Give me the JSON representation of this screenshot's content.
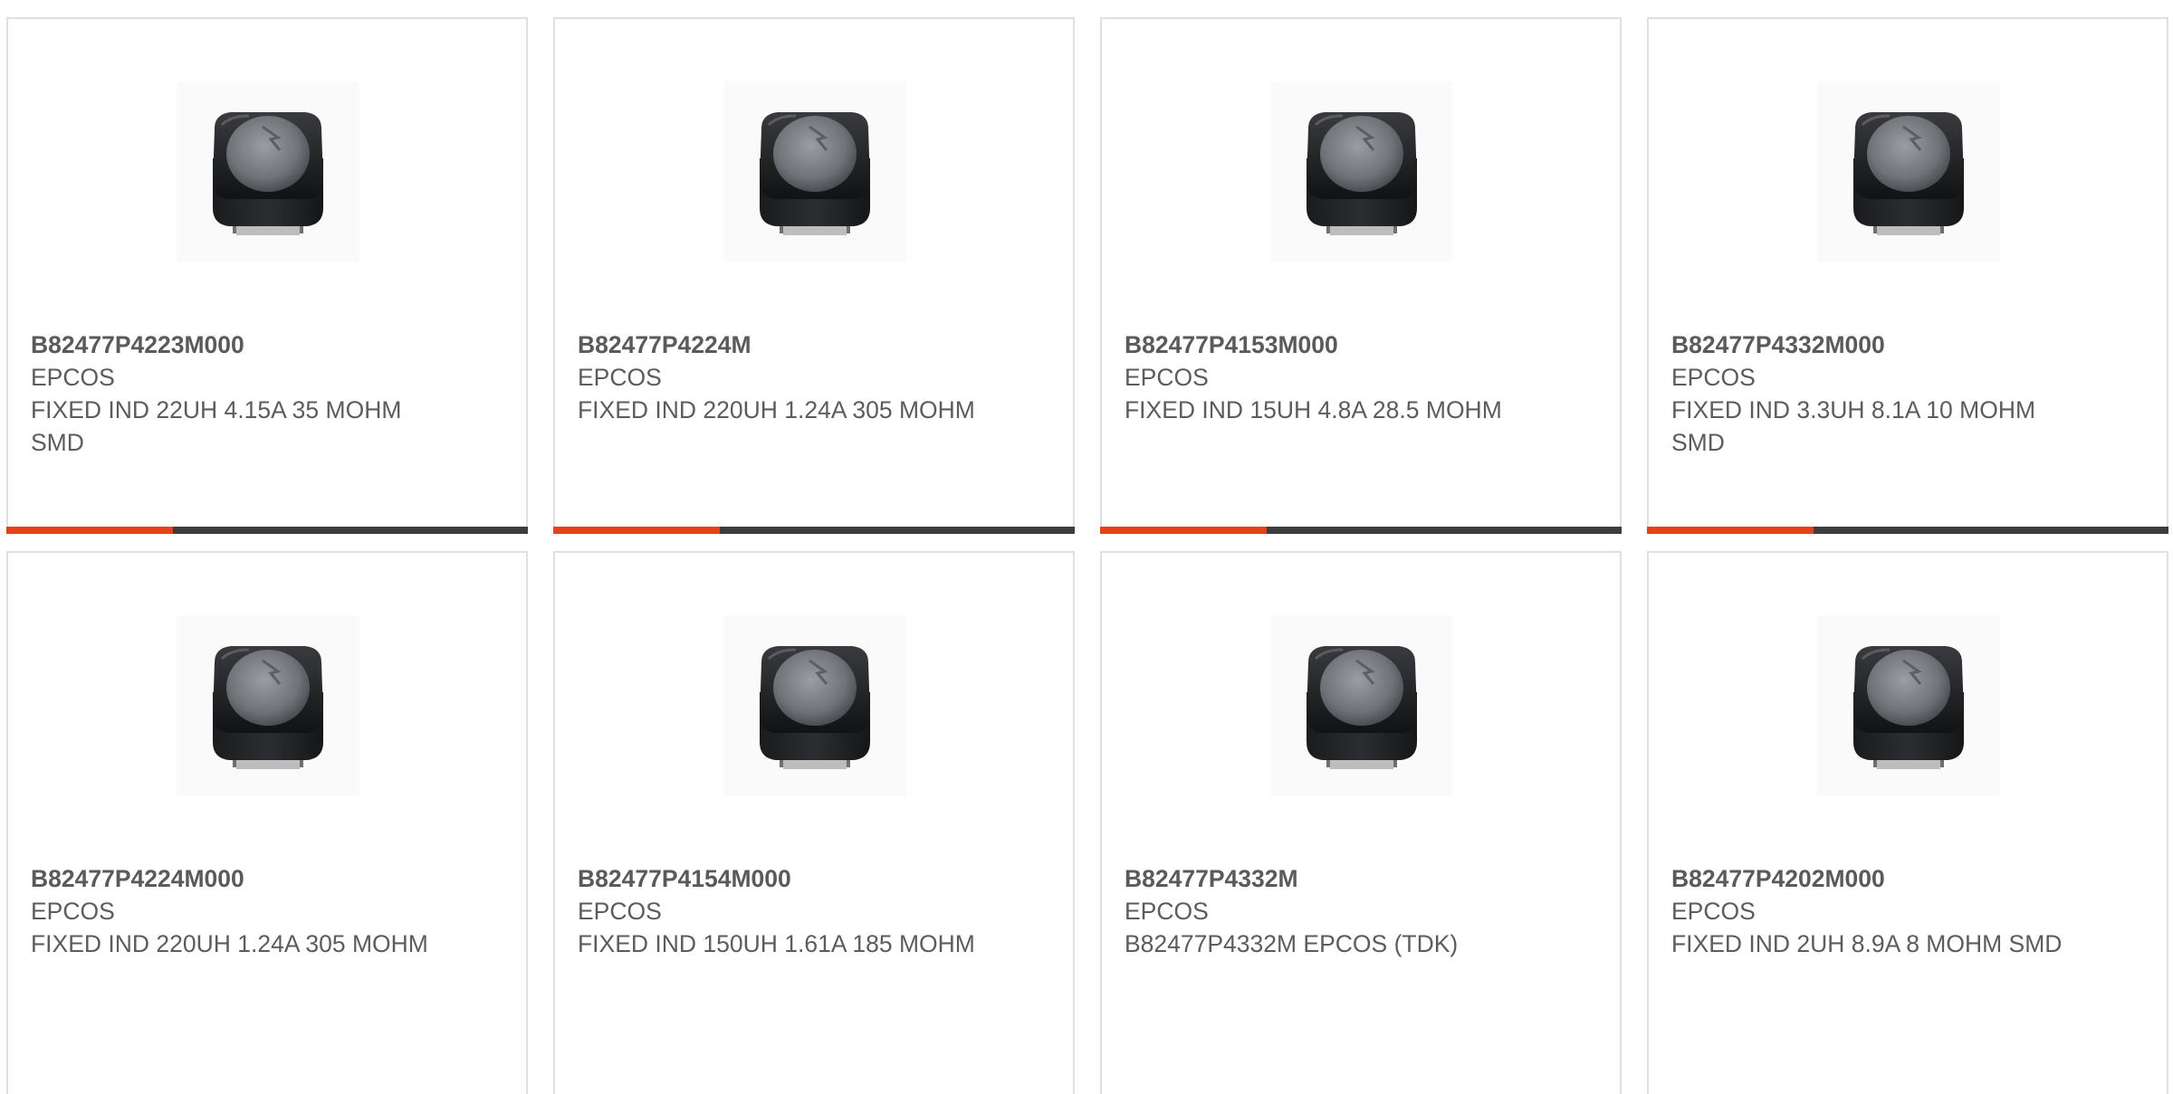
{
  "accent_color": "#e8401c",
  "cards": [
    {
      "part_number": "B82477P4223M000",
      "manufacturer": "EPCOS",
      "description": "FIXED IND 22UH 4.15A 35 MOHM SMD",
      "image": "inductor-image"
    },
    {
      "part_number": "B82477P4224M",
      "manufacturer": "EPCOS",
      "description": "FIXED IND 220UH 1.24A 305 MOHM",
      "image": "inductor-image"
    },
    {
      "part_number": "B82477P4153M000",
      "manufacturer": "EPCOS",
      "description": "FIXED IND 15UH 4.8A 28.5 MOHM",
      "image": "inductor-image"
    },
    {
      "part_number": "B82477P4332M000",
      "manufacturer": "EPCOS",
      "description": "FIXED IND 3.3UH 8.1A 10 MOHM SMD",
      "image": "inductor-image"
    },
    {
      "part_number": "B82477P4224M000",
      "manufacturer": "EPCOS",
      "description": "FIXED IND 220UH 1.24A 305 MOHM",
      "image": "inductor-image"
    },
    {
      "part_number": "B82477P4154M000",
      "manufacturer": "EPCOS",
      "description": "FIXED IND 150UH 1.61A 185 MOHM",
      "image": "inductor-image"
    },
    {
      "part_number": "B82477P4332M",
      "manufacturer": "EPCOS",
      "description": "B82477P4332M EPCOS (TDK)",
      "image": "inductor-image"
    },
    {
      "part_number": "B82477P4202M000",
      "manufacturer": "EPCOS",
      "description": "FIXED IND 2UH 8.9A 8 MOHM SMD",
      "image": "inductor-image"
    }
  ]
}
